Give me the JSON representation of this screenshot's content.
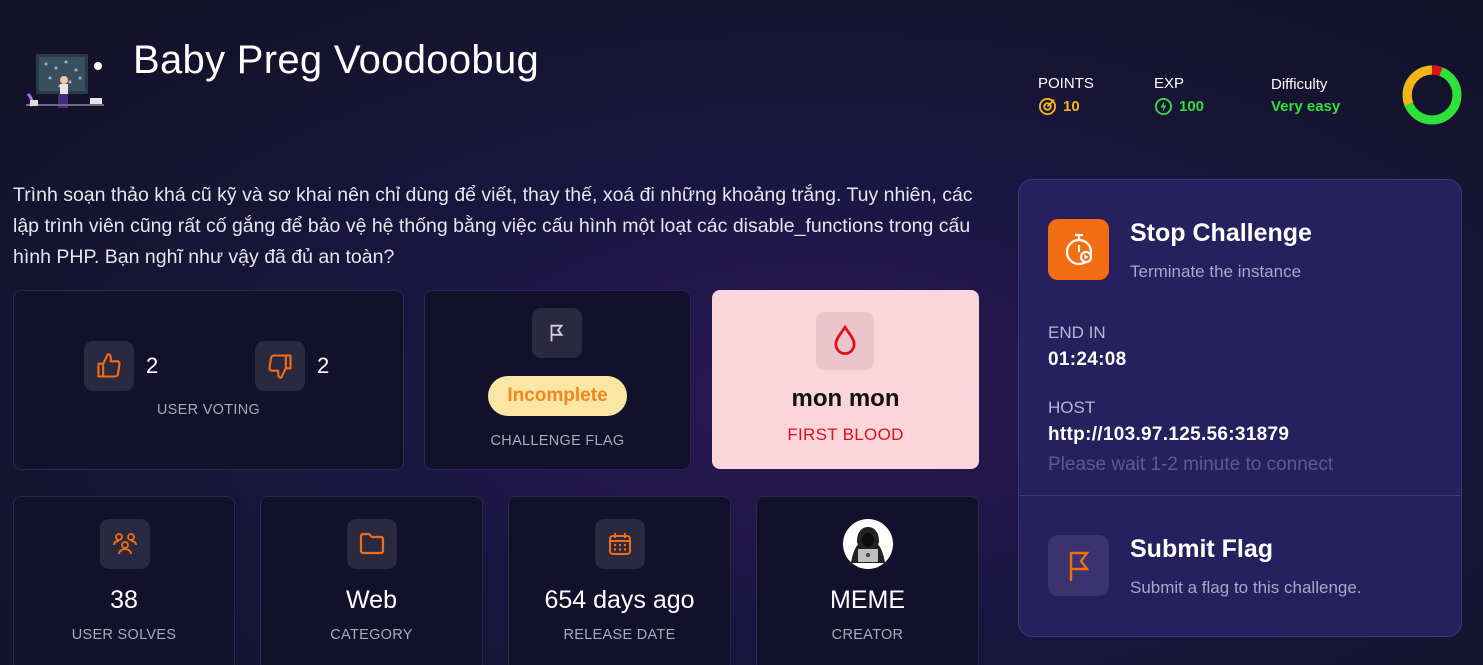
{
  "challenge": {
    "title": "Baby Preg Voodoobug",
    "description": "Trình soạn thảo khá cũ kỹ và sơ khai nên chỉ dùng để viết, thay thế, xoá đi những khoảng trắng. Tuy nhiên, các lập trình viên cũng rất cố gắng để bảo vệ hệ thống bằng việc cấu hình một loạt các disable_functions trong cấu hình PHP. Bạn nghĩ như vậy đã đủ an toàn?"
  },
  "stats": {
    "points_label": "POINTS",
    "points_value": "10",
    "exp_label": "EXP",
    "exp_value": "100",
    "difficulty_label": "Difficulty",
    "difficulty_value": "Very easy"
  },
  "voting": {
    "upvotes": "2",
    "downvotes": "2",
    "label": "USER VOTING"
  },
  "flag_status": {
    "status": "Incomplete",
    "label": "CHALLENGE FLAG"
  },
  "first_blood": {
    "name": "mon mon",
    "label": "FIRST BLOOD"
  },
  "info_cards": {
    "solves": {
      "value": "38",
      "label": "USER SOLVES"
    },
    "category": {
      "value": "Web",
      "label": "CATEGORY"
    },
    "release": {
      "value": "654 days ago",
      "label": "RELEASE DATE"
    },
    "creator": {
      "value": "MEME",
      "label": "CREATOR"
    }
  },
  "panel": {
    "stop_title": "Stop Challenge",
    "stop_sub": "Terminate the instance",
    "end_label": "END IN",
    "end_value": "01:24:08",
    "host_label": "HOST",
    "host_value": "http://103.97.125.56:31879",
    "host_hint": "Please wait 1-2 minute to connect",
    "submit_title": "Submit Flag",
    "submit_sub": "Submit a flag to this challenge."
  },
  "colors": {
    "accent_orange": "#f36d12",
    "points_gold": "#f5b416",
    "exp_green": "#2fe03a",
    "difficulty_green": "#2fe03a",
    "blood_red": "#e0101a",
    "panel_bg": "#27205f"
  },
  "icons": {
    "points": "target-coin-icon",
    "exp": "bolt-coin-icon",
    "upvote": "thumbs-up-icon",
    "downvote": "thumbs-down-icon",
    "flag": "flag-icon",
    "blood": "blood-drop-icon",
    "solves": "users-icon",
    "category": "folder-icon",
    "release": "calendar-icon",
    "stop": "stopwatch-icon",
    "submit": "flag-icon"
  }
}
